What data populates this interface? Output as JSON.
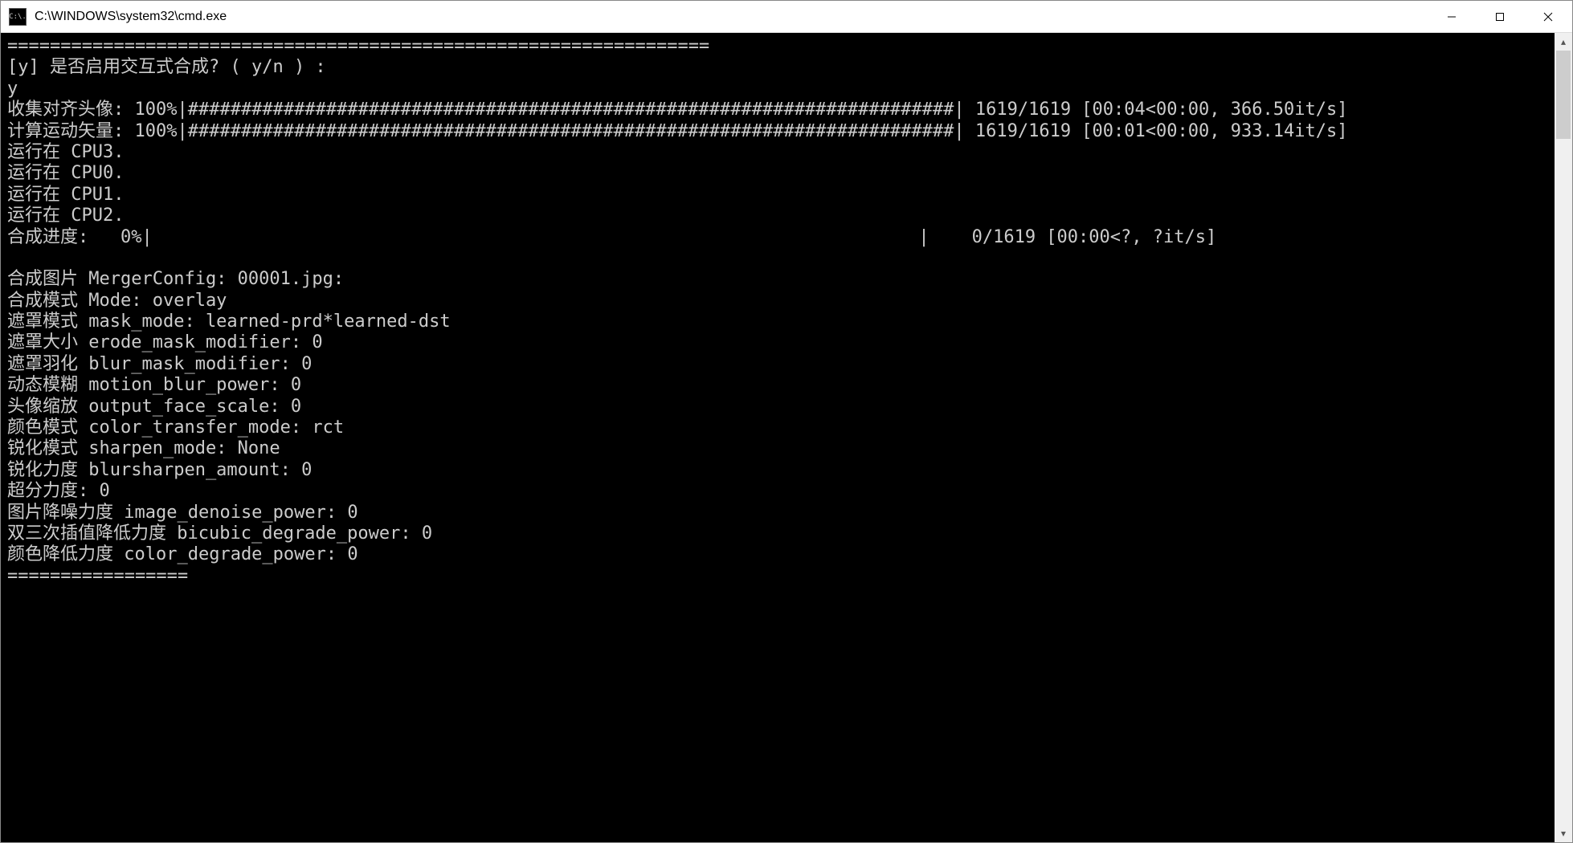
{
  "window": {
    "title": "C:\\WINDOWS\\system32\\cmd.exe",
    "icon_text": "C:\\."
  },
  "terminal": {
    "top_divider": "==================================================================",
    "prompt": "[y] 是否启用交互式合成? ( y/n ) :",
    "answer": "y",
    "progress1": {
      "label": "收集对齐头像:",
      "percent": "100%",
      "bar": "|########################################################################|",
      "count": "1619/1619",
      "time": "[00:04<00:00, 366.50it/s]"
    },
    "progress2": {
      "label": "计算运动矢量:",
      "percent": "100%",
      "bar": "|########################################################################|",
      "count": "1619/1619",
      "time": "[00:01<00:00, 933.14it/s]"
    },
    "cpu_lines": [
      "运行在 CPU3.",
      "运行在 CPU0.",
      "运行在 CPU1.",
      "运行在 CPU2."
    ],
    "progress3": {
      "label": "合成进度:",
      "percent": "  0%",
      "bar": "|                                                                        |",
      "count": "   0/1619",
      "time": "[00:00<?, ?it/s]"
    },
    "config_lines": [
      "合成图片 MergerConfig: 00001.jpg:",
      "合成模式 Mode: overlay",
      "遮罩模式 mask_mode: learned-prd*learned-dst",
      "遮罩大小 erode_mask_modifier: 0",
      "遮罩羽化 blur_mask_modifier: 0",
      "动态模糊 motion_blur_power: 0",
      "头像缩放 output_face_scale: 0",
      "颜色模式 color_transfer_mode: rct",
      "锐化模式 sharpen_mode: None",
      "锐化力度 blursharpen_amount: 0",
      "超分力度: 0",
      "图片降噪力度 image_denoise_power: 0",
      "双三次插值降低力度 bicubic_degrade_power: 0",
      "颜色降低力度 color_degrade_power: 0"
    ],
    "bottom_divider": "================="
  }
}
